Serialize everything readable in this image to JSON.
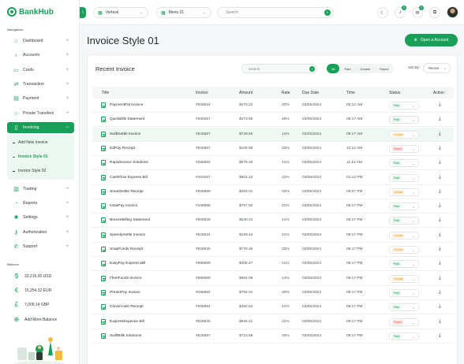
{
  "app": {
    "brand": "BankHub"
  },
  "colors": {
    "accent": "#18a058",
    "paid": "#18a058",
    "unpaid": "#e09a20",
    "reject": "#e05252"
  },
  "sidebar": {
    "section_nav": "Navigation",
    "items": [
      {
        "label": "Dashboard",
        "icon": "home-icon"
      },
      {
        "label": "Accounts",
        "icon": "piggy-bank-icon"
      },
      {
        "label": "Cards",
        "icon": "card-icon"
      },
      {
        "label": "Transaction",
        "icon": "transfer-icon"
      },
      {
        "label": "Payment",
        "icon": "wallet-icon"
      },
      {
        "label": "Private Transfers",
        "icon": "users-icon"
      },
      {
        "label": "Invoicing",
        "icon": "document-icon"
      },
      {
        "label": "Trading",
        "icon": "chart-icon"
      },
      {
        "label": "Reports",
        "icon": "reports-icon"
      },
      {
        "label": "Settings",
        "icon": "settings-icon"
      },
      {
        "label": "Authorization",
        "icon": "key-icon"
      },
      {
        "label": "Support",
        "icon": "support-icon"
      }
    ],
    "sub_items": [
      {
        "label": "Add New Invoice"
      },
      {
        "label": "Invoice Style 01"
      },
      {
        "label": "Invoice Style 02"
      }
    ],
    "section_balance": "Balance",
    "balances": [
      {
        "label": "33,215.00 USD",
        "icon": "dollar-icon"
      },
      {
        "label": "15,254.32 EUR",
        "icon": "euro-icon"
      },
      {
        "label": "7,009.14 GBP",
        "icon": "pound-icon"
      },
      {
        "label": "Add More Balance",
        "icon": "plus-circle-icon"
      }
    ]
  },
  "topbar": {
    "layout_select": "Vertical",
    "menu_select": "Menu 01",
    "search_placeholder": "Search",
    "badges": {
      "notifications": "3",
      "messages": "3"
    }
  },
  "page": {
    "title": "Invoice Style 01",
    "open_account_label": "Open a Account"
  },
  "invoice_card": {
    "title": "Recent Invoice",
    "search_placeholder": "Search",
    "filters": [
      "All",
      "Paid",
      "Unpaid",
      "Reject"
    ],
    "sort_label": "Sort By :",
    "sort_value": "Recent",
    "columns": [
      "Title",
      "Invoice",
      "Amount",
      "Rate",
      "Due Date",
      "Time",
      "Status",
      "Action"
    ],
    "rows": [
      {
        "title": "PaymentPal Invoice",
        "invoice": "#526534",
        "amount": "$475.22",
        "rate": "20%",
        "due": "03/05/2024",
        "time": "05:12 AM",
        "status": "Paid"
      },
      {
        "title": "QuickBills Statement",
        "invoice": "#200257",
        "amount": "$473.85",
        "rate": "26%",
        "due": "03/05/2024",
        "time": "08:17 AM",
        "status": "Paid"
      },
      {
        "title": "SwiftSettle Invoice",
        "invoice": "#526587",
        "amount": "$739.65",
        "rate": "14%",
        "due": "03/05/2024",
        "time": "09:17 AM",
        "status": "Unpaid"
      },
      {
        "title": "EZPay Receipt",
        "invoice": "#526587",
        "amount": "$106.58",
        "rate": "33%",
        "due": "03/05/2024",
        "time": "10:12 AM",
        "status": "Reject"
      },
      {
        "title": "RapidInvoice Solutions",
        "invoice": "#256584",
        "amount": "$578.28",
        "rate": "41%",
        "due": "03/05/2024",
        "time": "11:12 AM",
        "status": "Paid"
      },
      {
        "title": "CashFlow Express Bill",
        "invoice": "#200257",
        "amount": "$601.13",
        "rate": "22%",
        "due": "03/05/2024",
        "time": "01:12 PM",
        "status": "Paid"
      },
      {
        "title": "SmartSettle Receipt",
        "invoice": "#526589",
        "amount": "$293.01",
        "rate": "33%",
        "due": "03/05/2024",
        "time": "05:07 PM",
        "status": "Unpaid"
      },
      {
        "title": "InstaPay Invoice",
        "invoice": "#105986",
        "amount": "$767.50",
        "rate": "21%",
        "due": "03/05/2024",
        "time": "09:17 PM",
        "status": "Paid"
      },
      {
        "title": "BreezeBilling Statement",
        "invoice": "#526525",
        "amount": "$630.44",
        "rate": "41%",
        "due": "03/05/2024",
        "time": "09:17 PM",
        "status": "Paid"
      },
      {
        "title": "SpeedySettle Invoice",
        "invoice": "#526534",
        "amount": "$169.43",
        "rate": "21%",
        "due": "03/05/2024",
        "time": "09:17 PM",
        "status": "Unpaid"
      },
      {
        "title": "SnapFunds Receipt",
        "invoice": "#526520",
        "amount": "$778.35",
        "rate": "33%",
        "due": "03/05/2024",
        "time": "09:17 PM",
        "status": "Unpaid"
      },
      {
        "title": "EasyPay Express Bill",
        "invoice": "#696589",
        "amount": "$406.27",
        "rate": "21%",
        "due": "03/05/2024",
        "time": "09:17 PM",
        "status": "Paid"
      },
      {
        "title": "FleetFunds Invoice",
        "invoice": "#696589",
        "amount": "$654.09",
        "rate": "14%",
        "due": "03/05/2024",
        "time": "09:17 PM",
        "status": "Unpaid"
      },
      {
        "title": "PrestoPay Invoice",
        "invoice": "#256584",
        "amount": "$782.01",
        "rate": "20%",
        "due": "03/05/2024",
        "time": "09:17 PM",
        "status": "Paid"
      },
      {
        "title": "CleverCash Receipt",
        "invoice": "#256584",
        "amount": "$450.54",
        "rate": "41%",
        "due": "03/05/2024",
        "time": "09:17 PM",
        "status": "Paid"
      },
      {
        "title": "ExpressExpense Bill",
        "invoice": "#526525",
        "amount": "$926.41",
        "rate": "21%",
        "due": "03/05/2024",
        "time": "09:17 PM",
        "status": "Reject"
      },
      {
        "title": "SwiftBills Solutions",
        "invoice": "#526587",
        "amount": "$710.68",
        "rate": "33%",
        "due": "03/05/2024",
        "time": "09:17 PM",
        "status": "Paid"
      }
    ]
  }
}
